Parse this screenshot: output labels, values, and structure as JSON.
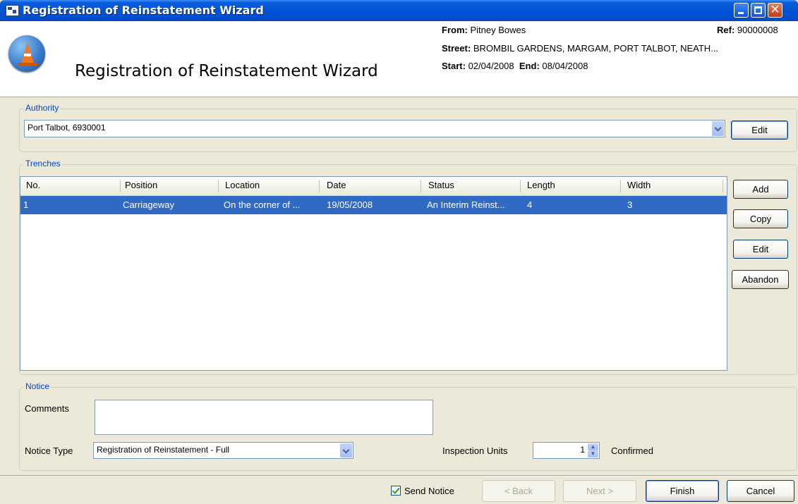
{
  "window": {
    "title": "Registration of Reinstatement Wizard"
  },
  "header": {
    "title": "Registration of Reinstatement Wizard",
    "from_label": "From:",
    "from_value": "Pitney Bowes",
    "ref_label": "Ref:",
    "ref_value": "90000008",
    "street_label": "Street:",
    "street_value": "BROMBIL GARDENS, MARGAM, PORT TALBOT, NEATH...",
    "start_label": "Start:",
    "start_value": "02/04/2008",
    "end_label": "End:",
    "end_value": "08/04/2008"
  },
  "authority": {
    "legend": "Authority",
    "value": "Port Talbot, 6930001",
    "edit_label": "Edit"
  },
  "trenches": {
    "legend": "Trenches",
    "columns": [
      "No.",
      "Position",
      "Location",
      "Date",
      "Status",
      "Length",
      "Width"
    ],
    "rows": [
      [
        "1",
        "Carriageway",
        "On the corner of ...",
        "19/05/2008",
        "An Interim Reinst...",
        "4",
        "3"
      ]
    ],
    "buttons": {
      "add": "Add",
      "copy": "Copy",
      "edit": "Edit",
      "abandon": "Abandon"
    }
  },
  "notice": {
    "legend": "Notice",
    "comments_label": "Comments",
    "comments_value": "",
    "notice_type_label": "Notice Type",
    "notice_type_value": "Registration of Reinstatement - Full",
    "inspection_units_label": "Inspection Units",
    "inspection_units_value": "1",
    "confirmed_label": "Confirmed"
  },
  "footer": {
    "send_notice_label": "Send Notice",
    "send_notice_checked": true,
    "back_label": "< Back",
    "next_label": "Next >",
    "finish_label": "Finish",
    "cancel_label": "Cancel"
  }
}
